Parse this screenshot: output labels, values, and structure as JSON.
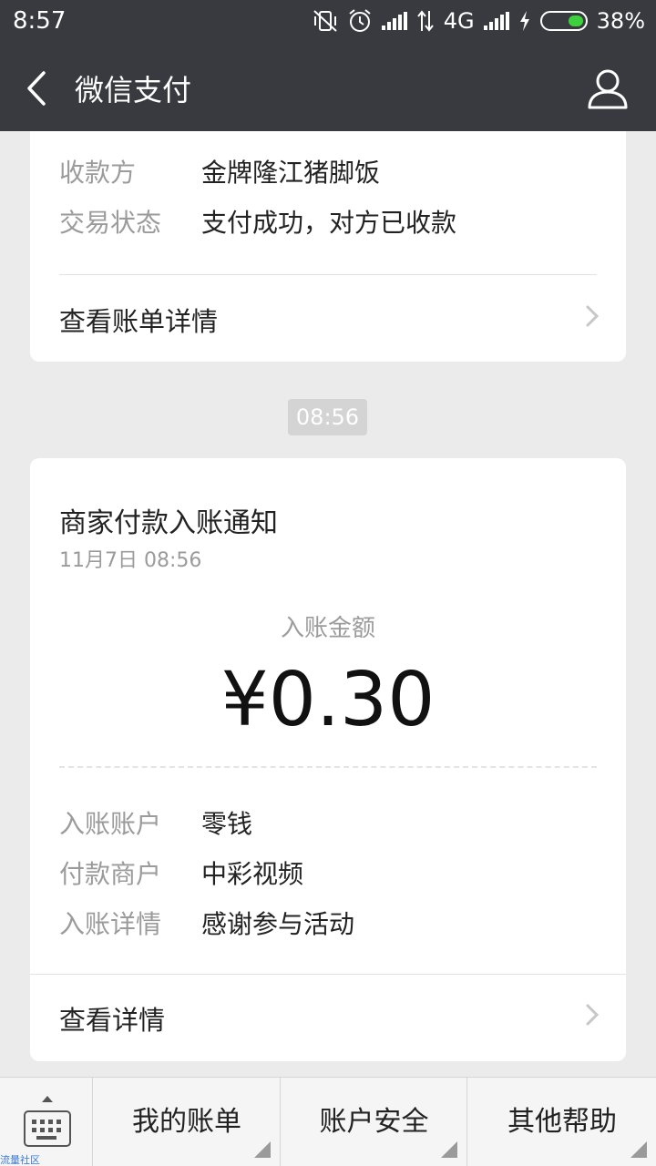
{
  "status_bar": {
    "time": "8:57",
    "network": "4G",
    "battery_percent": "38%",
    "battery_level": 0.38,
    "icons": [
      "vibrate-off-icon",
      "alarm-icon",
      "signal-icon",
      "data-transfer-icon",
      "signal-icon",
      "charging-icon",
      "battery-icon"
    ],
    "battery_color": "#3dd13d"
  },
  "nav": {
    "title": "微信支付",
    "back_icon": "chevron-left-icon",
    "profile_icon": "person-icon",
    "bar_color": "#393a3f"
  },
  "prev_message": {
    "rows": [
      {
        "label": "收款方",
        "value": "金牌隆江猪脚饭"
      },
      {
        "label": "交易状态",
        "value": "支付成功，对方已收款"
      }
    ],
    "link": "查看账单详情"
  },
  "timestamp": "08:56",
  "notice": {
    "title": "商家付款入账通知",
    "date": "11月7日  08:56",
    "amount_label": "入账金额",
    "amount": "¥0.30",
    "rows": [
      {
        "label": "入账账户",
        "value": "零钱"
      },
      {
        "label": "付款商户",
        "value": "中彩视频"
      },
      {
        "label": "入账详情",
        "value": "感谢参与活动"
      }
    ],
    "link": "查看详情"
  },
  "bottom_menu": {
    "keyboard_icon": "keyboard-icon",
    "items": [
      "我的账单",
      "账户安全",
      "其他帮助"
    ],
    "watermark": "流量社区"
  }
}
